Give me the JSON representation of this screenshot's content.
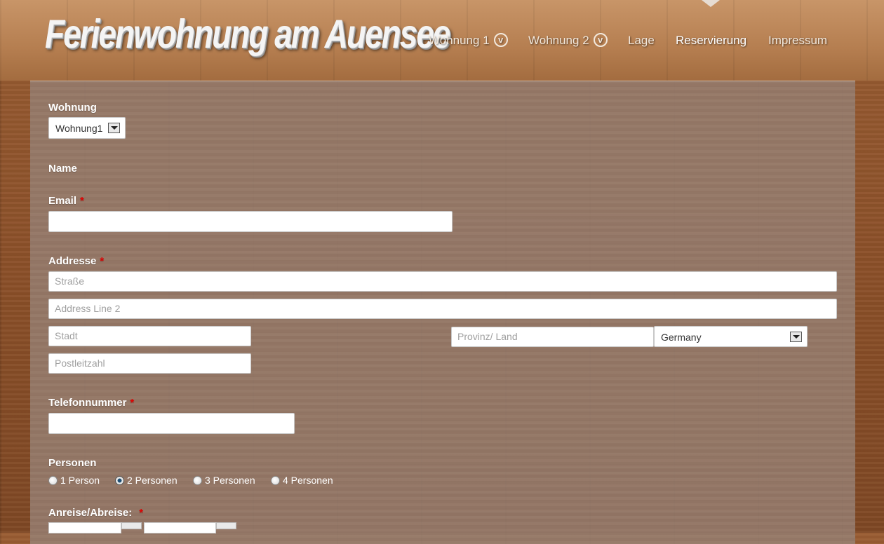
{
  "site": {
    "title": "Ferienwohnung am Auensee"
  },
  "nav": {
    "items": [
      {
        "label": "Wohnung 1",
        "chevron": "v"
      },
      {
        "label": "Wohnung 2",
        "chevron": "v"
      },
      {
        "label": "Lage"
      },
      {
        "label": "Reservierung",
        "active": true
      },
      {
        "label": "Impressum"
      }
    ]
  },
  "form": {
    "wohnung": {
      "label": "Wohnung",
      "selected": "Wohnung1"
    },
    "name": {
      "label": "Name"
    },
    "email": {
      "label": "Email",
      "required_mark": "*",
      "value": ""
    },
    "address": {
      "label": "Addresse",
      "required_mark": "*",
      "street_placeholder": "Straße",
      "line2_placeholder": "Address Line 2",
      "city_placeholder": "Stadt",
      "province_placeholder": "Provinz/ Land",
      "zip_placeholder": "Postleitzahl",
      "country_selected": "Germany"
    },
    "phone": {
      "label": "Telefonnummer",
      "required_mark": "*",
      "value": ""
    },
    "persons": {
      "label": "Personen",
      "options": [
        "1 Person",
        "2 Personen",
        "3 Personen",
        "4 Personen"
      ],
      "selected": "2 Personen"
    },
    "dates": {
      "label": "Anreise/Abreise:",
      "required_mark": "*"
    }
  },
  "colors": {
    "required": "#e00000",
    "radio_checked": "#1d4e74"
  }
}
